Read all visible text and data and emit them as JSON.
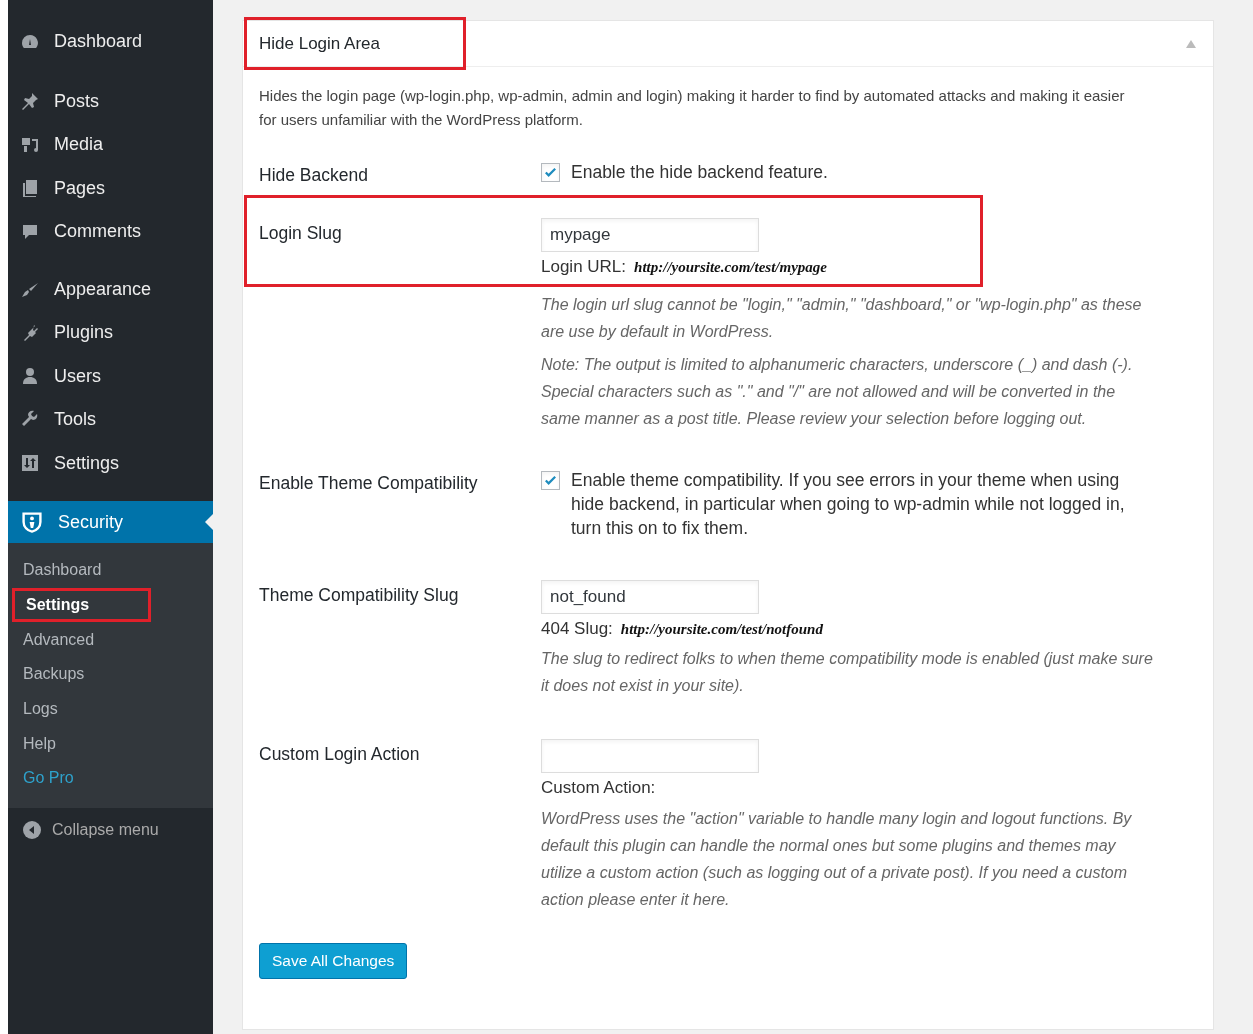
{
  "sidebar": {
    "groups": [
      [
        {
          "label": "Dashboard",
          "selected": false
        }
      ],
      [
        {
          "label": "Posts",
          "selected": false
        },
        {
          "label": "Media",
          "selected": false
        },
        {
          "label": "Pages",
          "selected": false
        },
        {
          "label": "Comments",
          "selected": false
        }
      ],
      [
        {
          "label": "Appearance",
          "selected": false
        },
        {
          "label": "Plugins",
          "selected": false
        },
        {
          "label": "Users",
          "selected": false
        },
        {
          "label": "Tools",
          "selected": false
        },
        {
          "label": "Settings",
          "selected": false
        }
      ],
      [
        {
          "label": "Security",
          "selected": true
        }
      ]
    ],
    "submenu": [
      {
        "label": "Dashboard",
        "kind": "link",
        "selected": false,
        "highlighted": false
      },
      {
        "label": "Settings",
        "kind": "link",
        "selected": true,
        "highlighted": true
      },
      {
        "label": "Advanced",
        "kind": "link",
        "selected": false,
        "highlighted": false
      },
      {
        "label": "Backups",
        "kind": "link",
        "selected": false,
        "highlighted": false
      },
      {
        "label": "Logs",
        "kind": "link",
        "selected": false,
        "highlighted": false
      },
      {
        "label": "Help",
        "kind": "link",
        "selected": false,
        "highlighted": false
      },
      {
        "label": "Go Pro",
        "kind": "promo",
        "selected": false,
        "highlighted": false
      }
    ],
    "collapse": "Collapse menu"
  },
  "panel": {
    "title": "Hide Login Area",
    "title_highlighted": true,
    "expanded": true,
    "description": "Hides the login page (wp-login.php, wp-admin, admin and login) making it harder to find by automated attacks and making it easier for users unfamiliar with the WordPress platform.",
    "rows": [
      {
        "kind": "checkbox",
        "label": "Hide Backend",
        "checked": true,
        "text": "Enable the hide backend feature.",
        "highlighted": false
      },
      {
        "kind": "text",
        "label": "Login Slug",
        "value": "mypage",
        "url_label": "Login URL:",
        "url": "http://yoursite.com/test/mypage",
        "highlighted": true,
        "notes": [
          "The login url slug cannot be \"login,\" \"admin,\" \"dashboard,\" or \"wp-login.php\" as these are use by default in WordPress.",
          "Note: The output is limited to alphanumeric characters, underscore (_) and dash (-). Special characters such as \".\" and \"/\" are not allowed and will be converted in the same manner as a post title. Please review your selection before logging out."
        ]
      },
      {
        "kind": "checkbox",
        "label": "Enable Theme Compatibility",
        "checked": true,
        "text": "Enable theme compatibility. If you see errors in your theme when using hide backend, in particular when going to wp-admin while not logged in, turn this on to fix them.",
        "highlighted": false
      },
      {
        "kind": "text",
        "label": "Theme Compatibility Slug",
        "value": "not_found",
        "url_label": "404 Slug:",
        "url": "http://yoursite.com/test/notfound",
        "highlighted": false,
        "notes": [
          "The slug to redirect folks to when theme compatibility mode is enabled (just make sure it does not exist in your site)."
        ]
      },
      {
        "kind": "text",
        "label": "Custom Login Action",
        "url_label": "Custom Action:",
        "highlighted": false,
        "notes": [
          "WordPress uses the \"action\" variable to handle many login and logout functions. By default this plugin can handle the normal ones but some plugins and themes may utilize a custom action (such as logging out of a private post). If you need a custom action please enter it here."
        ]
      }
    ],
    "save": "Save All Changes"
  }
}
